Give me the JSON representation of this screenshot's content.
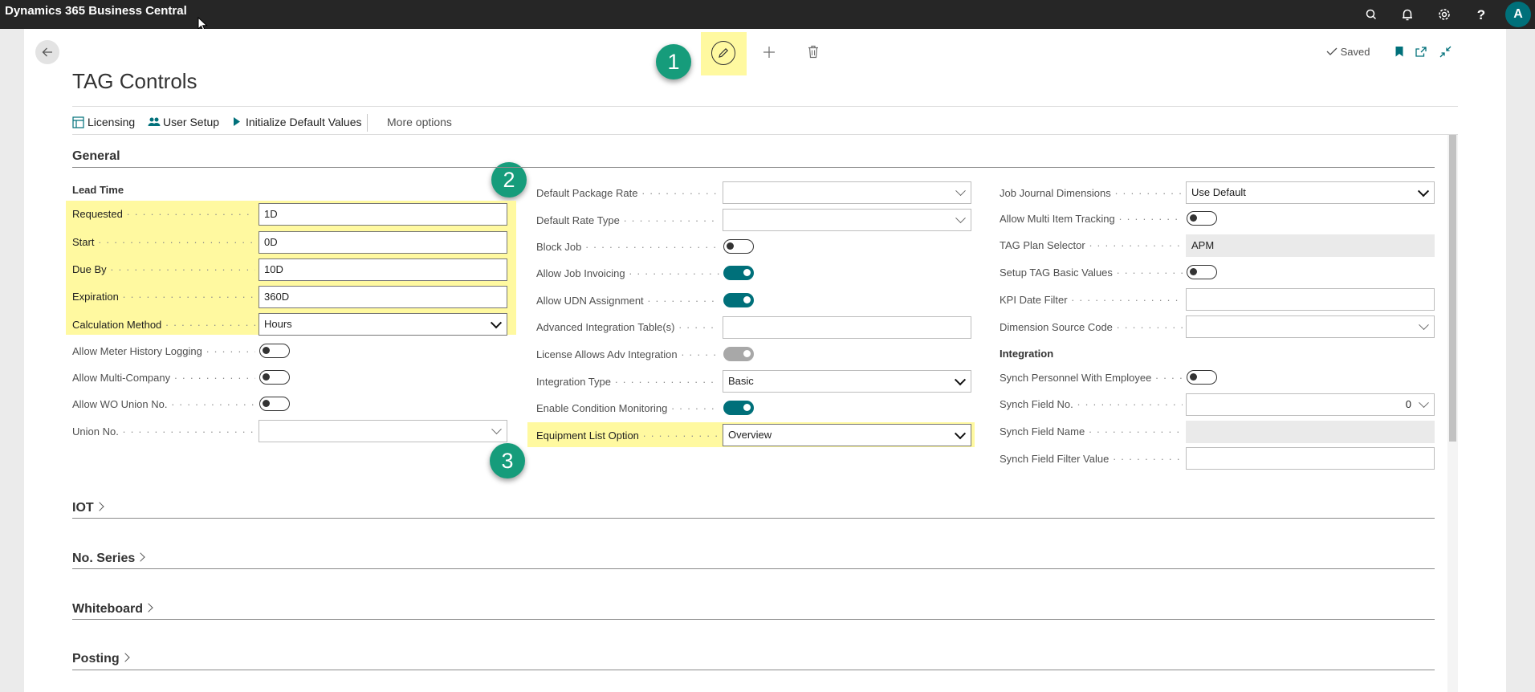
{
  "app": {
    "title": "Dynamics 365 Business Central",
    "avatar_initial": "A"
  },
  "page": {
    "title": "TAG Controls",
    "status": "Saved"
  },
  "annotations": [
    "1",
    "2",
    "3"
  ],
  "actions": {
    "licensing": "Licensing",
    "user_setup": "User Setup",
    "initialize": "Initialize Default Values",
    "more": "More options"
  },
  "general": {
    "title": "General",
    "lead_time": {
      "title": "Lead Time",
      "requested": {
        "label": "Requested",
        "value": "1D"
      },
      "start": {
        "label": "Start",
        "value": "0D"
      },
      "due_by": {
        "label": "Due By",
        "value": "10D"
      },
      "expiration": {
        "label": "Expiration",
        "value": "360D"
      },
      "calculation_method": {
        "label": "Calculation Method",
        "value": "Hours"
      }
    },
    "allow_meter_history_logging": {
      "label": "Allow Meter History Logging",
      "on": false
    },
    "allow_multi_company": {
      "label": "Allow Multi-Company",
      "on": false
    },
    "allow_wo_union": {
      "label": "Allow WO Union No.",
      "on": false
    },
    "union_no": {
      "label": "Union No.",
      "value": ""
    },
    "default_package_rate": {
      "label": "Default Package Rate",
      "value": ""
    },
    "default_rate_type": {
      "label": "Default Rate Type",
      "value": ""
    },
    "block_job": {
      "label": "Block Job",
      "on": false
    },
    "allow_job_invoicing": {
      "label": "Allow Job Invoicing",
      "on": true
    },
    "allow_udn_assignment": {
      "label": "Allow UDN Assignment",
      "on": true
    },
    "advanced_integration_tables": {
      "label": "Advanced Integration Table(s)",
      "value": ""
    },
    "license_allows_adv_integration": {
      "label": "License Allows Adv Integration",
      "on": true
    },
    "integration_type": {
      "label": "Integration Type",
      "value": "Basic"
    },
    "enable_condition_monitoring": {
      "label": "Enable Condition Monitoring",
      "on": true
    },
    "equipment_list_option": {
      "label": "Equipment List Option",
      "value": "Overview"
    },
    "job_journal_dimensions": {
      "label": "Job Journal Dimensions",
      "value": "Use Default"
    },
    "allow_multi_item_tracking": {
      "label": "Allow Multi Item Tracking",
      "on": false
    },
    "tag_plan_selector": {
      "label": "TAG Plan Selector",
      "value": "APM"
    },
    "setup_tag_basic_values": {
      "label": "Setup TAG Basic Values",
      "on": false
    },
    "kpi_date_filter": {
      "label": "KPI Date Filter",
      "value": ""
    },
    "dimension_source_code": {
      "label": "Dimension Source Code",
      "value": ""
    },
    "integration": {
      "title": "Integration",
      "synch_personnel": {
        "label": "Synch Personnel With Employee",
        "on": false
      },
      "synch_field_no": {
        "label": "Synch Field No.",
        "value": "0"
      },
      "synch_field_name": {
        "label": "Synch Field Name",
        "value": ""
      },
      "synch_field_filter": {
        "label": "Synch Field Filter Value",
        "value": ""
      }
    }
  },
  "sections": {
    "iot": "IOT",
    "no_series": "No. Series",
    "whiteboard": "Whiteboard",
    "posting": "Posting"
  },
  "colors": {
    "accent": "#00707a",
    "highlight": "#fff9a0",
    "badge": "#169c7b",
    "topbar": "#262626"
  }
}
